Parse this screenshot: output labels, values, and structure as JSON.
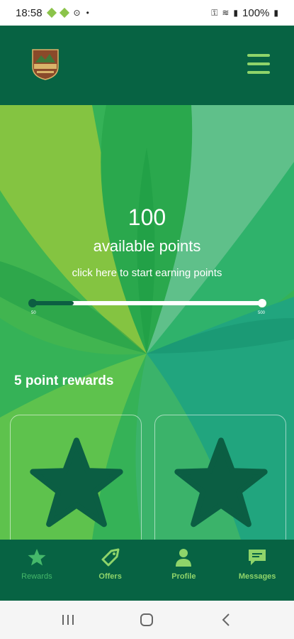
{
  "status_bar": {
    "time": "18:58",
    "battery": "100%"
  },
  "header": {
    "logo_icon": "happy-camper-logo",
    "menu_icon": "hamburger-menu-icon"
  },
  "points": {
    "value": "100",
    "label": "available points",
    "earn_link": "click here to start earning points",
    "progress_min": "50",
    "progress_max": "500",
    "progress_fraction": 0.18
  },
  "rewards": {
    "section_title": "5 point rewards",
    "cards": [
      {
        "icon": "star-icon"
      },
      {
        "icon": "star-icon"
      }
    ]
  },
  "nav": {
    "items": [
      {
        "label": "Rewards",
        "icon": "star-icon",
        "active": true
      },
      {
        "label": "Offers",
        "icon": "tag-icon",
        "active": false
      },
      {
        "label": "Profile",
        "icon": "person-icon",
        "active": false
      },
      {
        "label": "Messages",
        "icon": "chat-icon",
        "active": false
      }
    ]
  },
  "colors": {
    "header_bg": "#076343",
    "accent": "#8fd46a",
    "active": "#45b86a",
    "star": "#0b5e43"
  }
}
